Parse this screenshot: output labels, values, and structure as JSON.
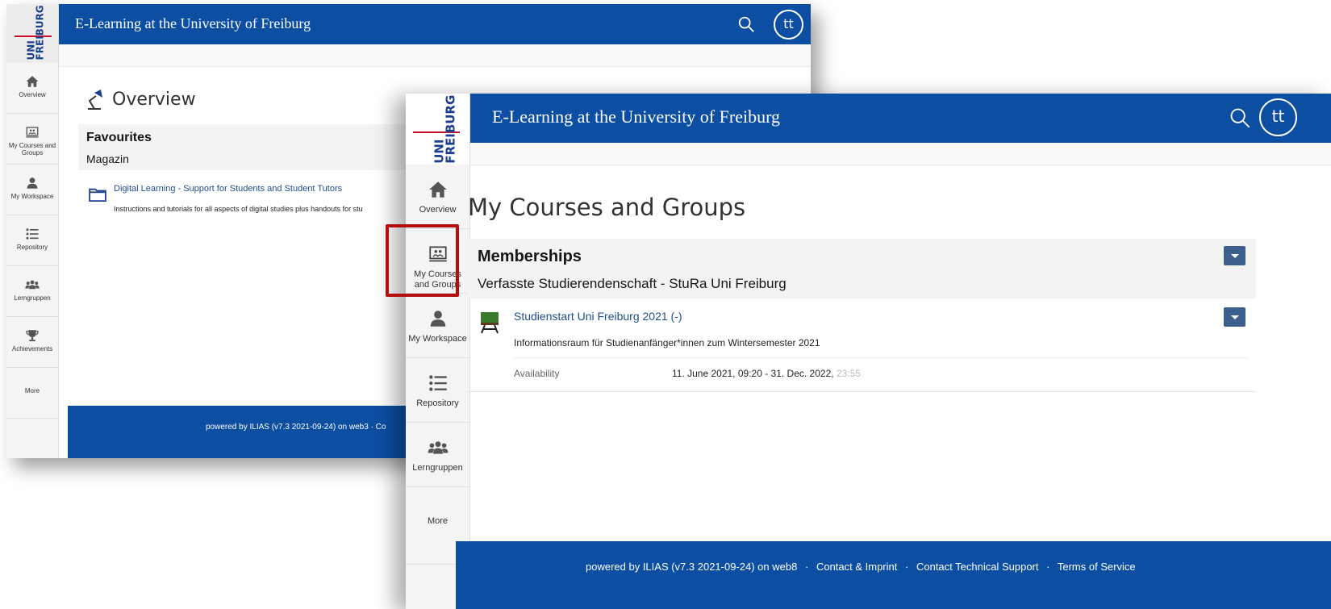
{
  "app": {
    "site_title": "E-Learning at the University of Freiburg",
    "logo_text_top": "UNI",
    "logo_text_bottom": "FREIBURG",
    "avatar_initials": "tt",
    "brand_color": "#0b4ea2",
    "highlight_color": "#b40d0d"
  },
  "back_window": {
    "sidebar": [
      {
        "label": "Overview",
        "icon": "home-icon"
      },
      {
        "label": "My Courses and Groups",
        "icon": "courses-icon"
      },
      {
        "label": "My Workspace",
        "icon": "user-icon"
      },
      {
        "label": "Repository",
        "icon": "list-icon"
      },
      {
        "label": "Lerngruppen",
        "icon": "group-icon"
      },
      {
        "label": "Achievements",
        "icon": "trophy-icon"
      },
      {
        "label": "More",
        "icon": ""
      }
    ],
    "page_title": "Overview",
    "favourites_title": "Favourites",
    "favourites_subtitle": "Magazin",
    "item_link": "Digital Learning - Support for Students and Student Tutors",
    "item_description": "Instructions and tutorials for all aspects of digital studies plus handouts for stu",
    "footer": "powered by ILIAS (v7.3 2021-09-24) on web3  ·  Co"
  },
  "front_window": {
    "sidebar": [
      {
        "label": "Overview",
        "icon": "home-icon"
      },
      {
        "label": "My Courses and Groups",
        "icon": "courses-icon"
      },
      {
        "label": "My Workspace",
        "icon": "user-icon"
      },
      {
        "label": "Repository",
        "icon": "list-icon"
      },
      {
        "label": "Lerngruppen",
        "icon": "group-icon"
      },
      {
        "label": "More",
        "icon": ""
      }
    ],
    "page_title": "My Courses and Groups",
    "memberships_title": "Memberships",
    "memberships_subtitle": "Verfasste Studierendenschaft - StuRa Uni Freiburg",
    "item_link": "Studienstart Uni Freiburg 2021 (-)",
    "item_description": "Informationsraum für Studienanfänger*innen zum Wintersemester 2021",
    "property_label": "Availability",
    "property_value": "11. June 2021, 09:20 - 31. Dec. 2022, ",
    "property_value_faded": "23:55",
    "footer_links": {
      "powered": "powered by ILIAS (v7.3 2021-09-24) on web8",
      "contact": "Contact & Imprint",
      "support": "Contact Technical Support",
      "terms": "Terms of Service",
      "separator": "·"
    }
  }
}
